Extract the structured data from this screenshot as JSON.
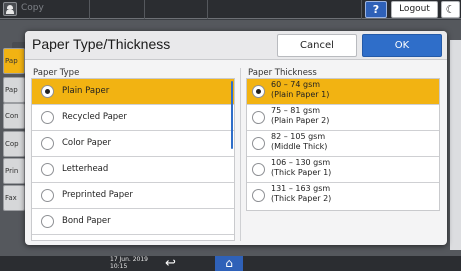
{
  "topbar": {
    "app_title": "Copy",
    "help_label": "?",
    "logout_label": "Logout",
    "moon_label": "☾"
  },
  "background": {
    "left_items": [
      "Pap",
      "Pap",
      "Con",
      "Cop",
      "Prin",
      "Fax"
    ]
  },
  "dialog": {
    "title": "Paper Type/Thickness",
    "cancel_label": "Cancel",
    "ok_label": "OK",
    "paper_type": {
      "label": "Paper Type",
      "items": [
        "Plain Paper",
        "Recycled Paper",
        "Color Paper",
        "Letterhead",
        "Preprinted Paper",
        "Bond Paper"
      ],
      "selected_index": 0
    },
    "paper_thickness": {
      "label": "Paper Thickness",
      "items": [
        {
          "range": "60 – 74 gsm",
          "name": "(Plain Paper 1)"
        },
        {
          "range": "75 – 81 gsm",
          "name": "(Plain Paper 2)"
        },
        {
          "range": "82 – 105 gsm",
          "name": "(Middle Thick)"
        },
        {
          "range": "106 – 130 gsm",
          "name": "(Thick Paper 1)"
        },
        {
          "range": "131 – 163 gsm",
          "name": "(Thick Paper 2)"
        }
      ],
      "selected_index": 0
    }
  },
  "bottombar": {
    "date": "17 Jun. 2019",
    "time": "10:15",
    "back_icon": "↩",
    "home_icon": "⌂"
  },
  "colors": {
    "selected": "#f2b312",
    "ok_button": "#2f6ec9"
  }
}
